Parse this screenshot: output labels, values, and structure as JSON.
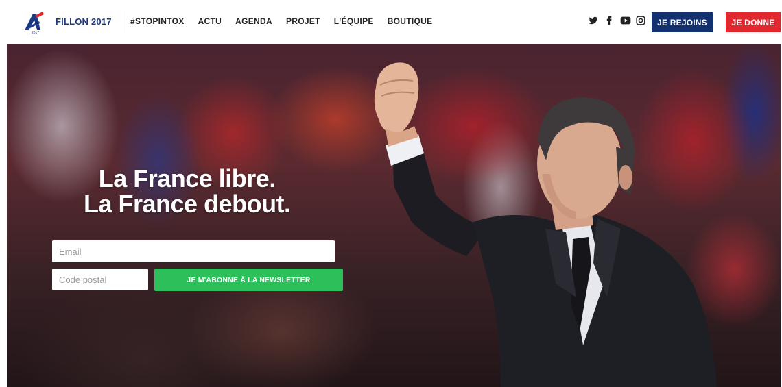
{
  "header": {
    "brand": "FILLON 2017",
    "logo_year": "2017",
    "nav": [
      "#STOPINTOX",
      "ACTU",
      "AGENDA",
      "PROJET",
      "L'ÉQUIPE",
      "BOUTIQUE"
    ],
    "social_icons": [
      "twitter-icon",
      "facebook-icon",
      "youtube-icon",
      "instagram-icon"
    ],
    "join_label": "JE REJOINS",
    "donate_label": "JE DONNE"
  },
  "hero": {
    "headline_line1": "La France libre.",
    "headline_line2": "La France debout.",
    "email_placeholder": "Email",
    "postal_placeholder": "Code postal",
    "subscribe_label": "JE M'ABONNE À LA NEWSLETTER"
  },
  "colors": {
    "brand_blue": "#14316f",
    "donate_red": "#e1282f",
    "subscribe_green": "#2dbf5a"
  }
}
